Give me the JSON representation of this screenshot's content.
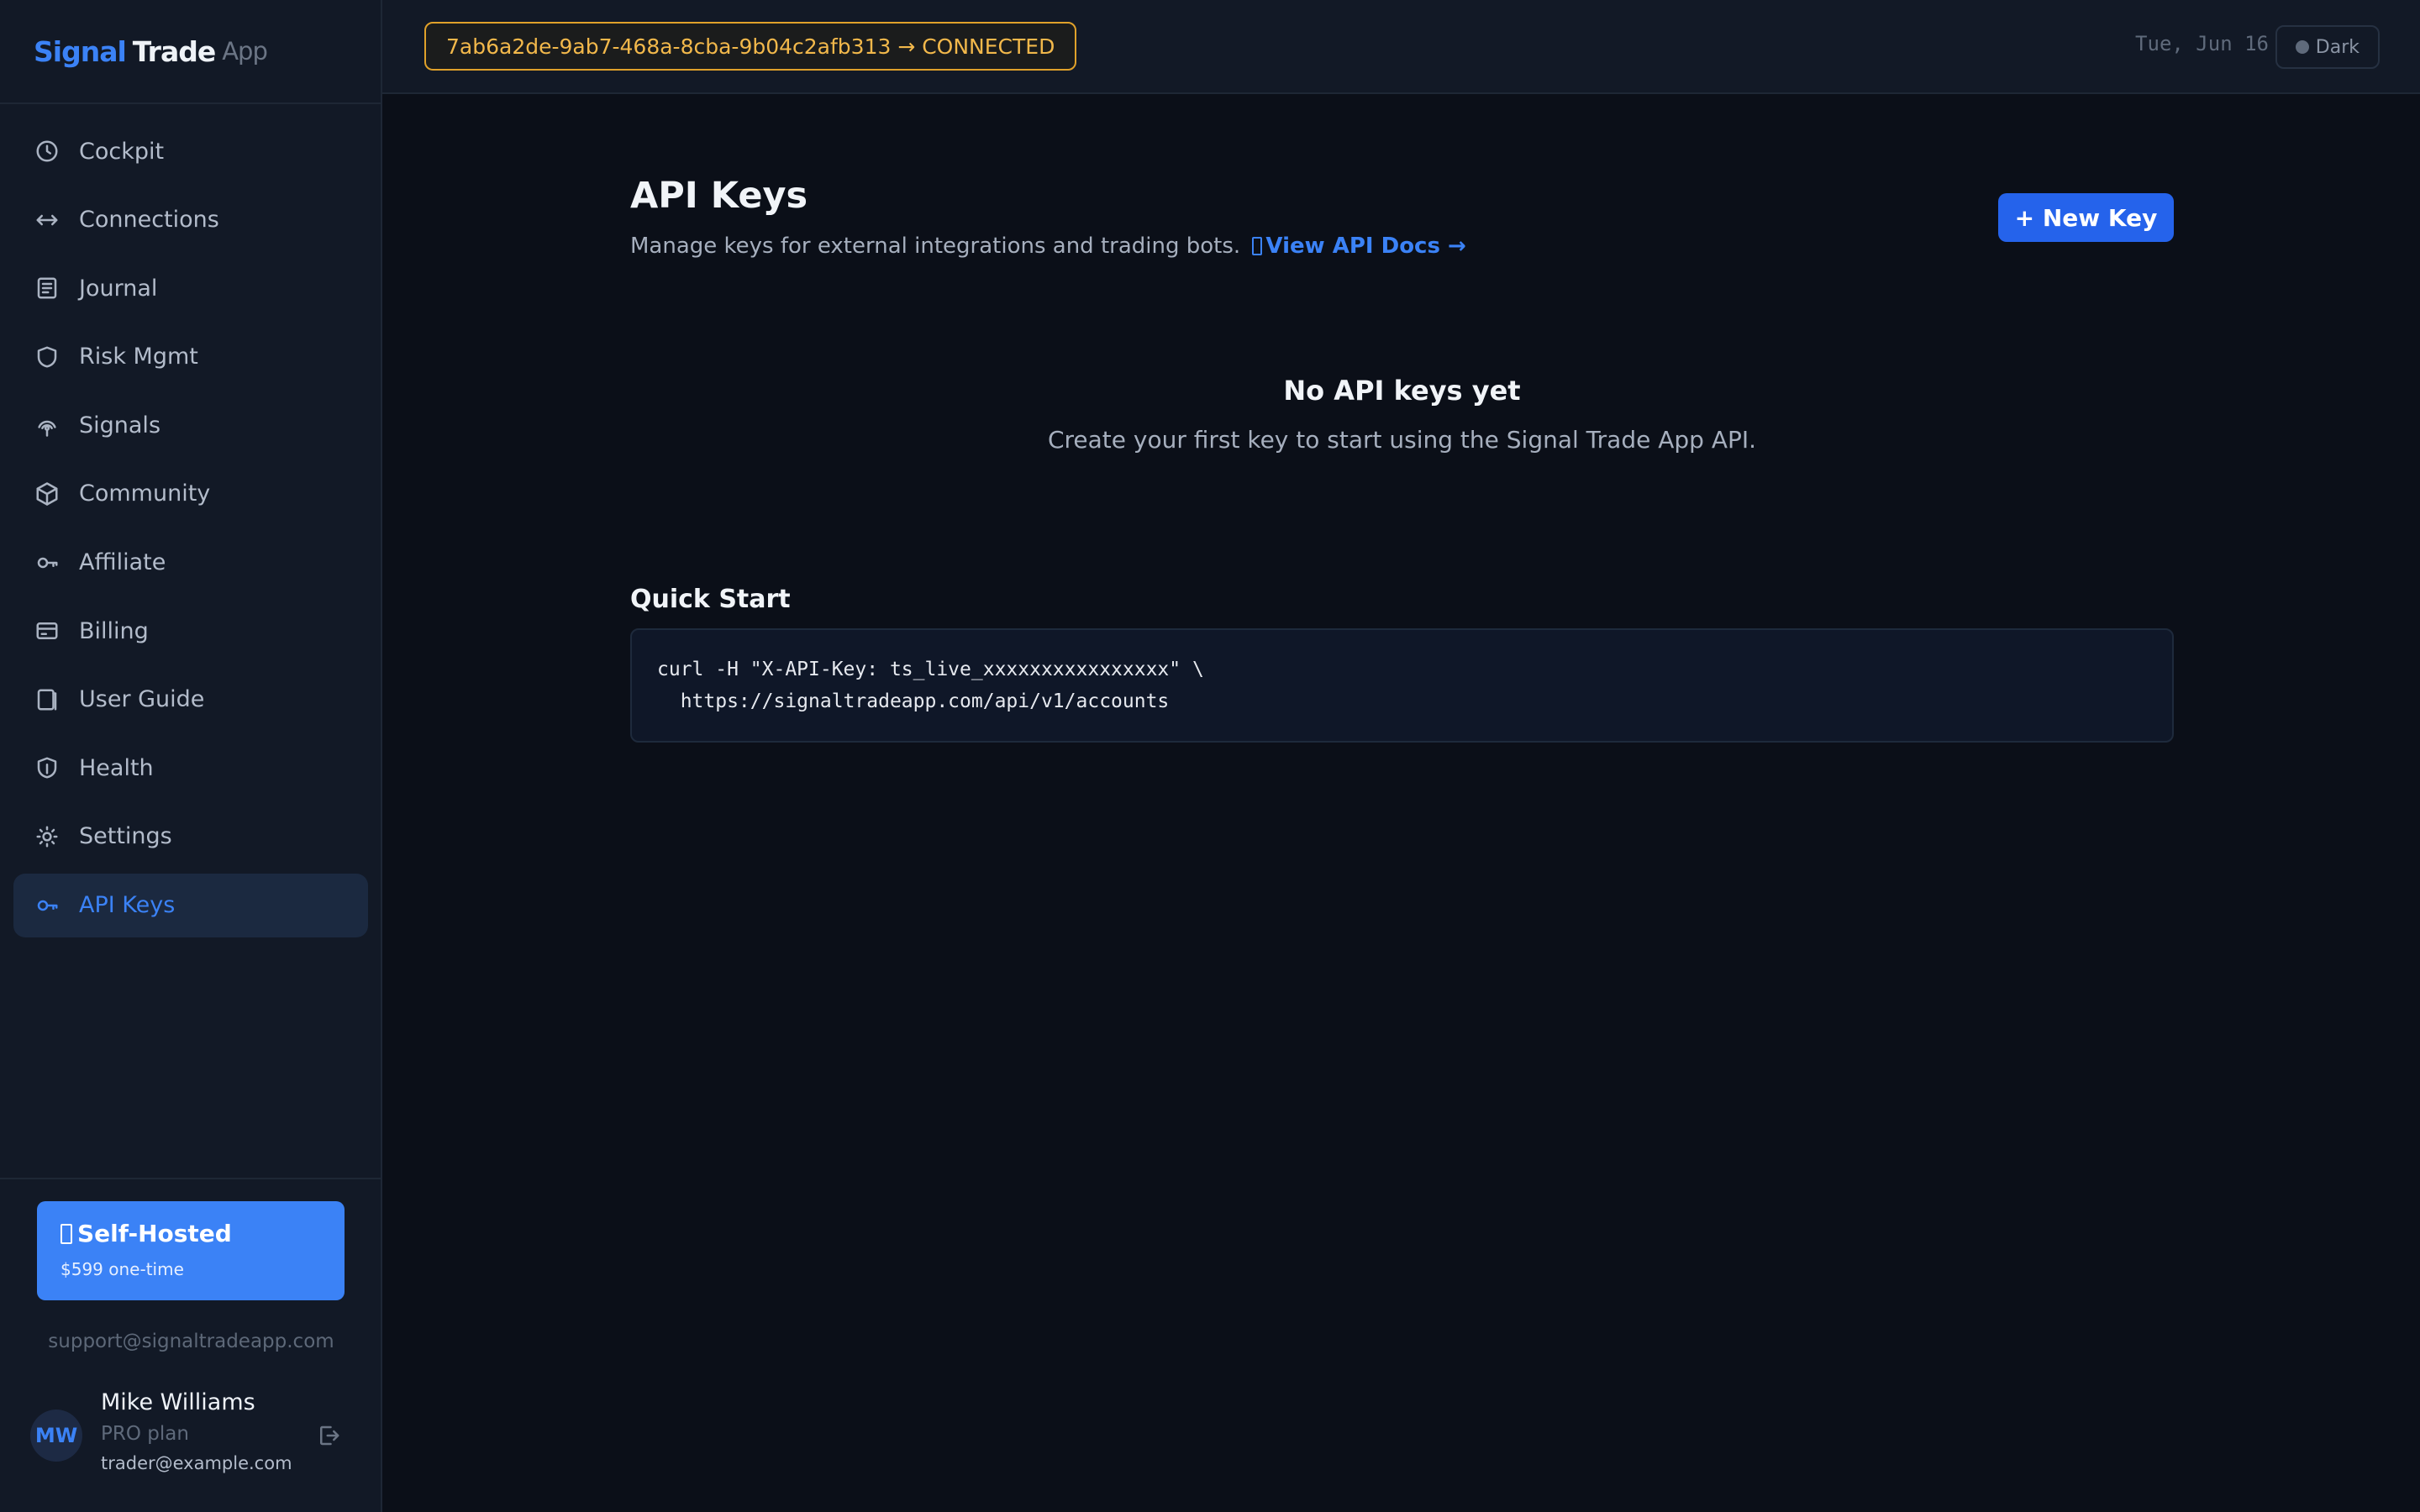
{
  "brand": {
    "part1": "Signal",
    "part2": "Trade",
    "part3": "App"
  },
  "sidebar": {
    "items": [
      {
        "label": "Cockpit",
        "icon": "clock-icon"
      },
      {
        "label": "Connections",
        "icon": "arrows-horizontal-icon"
      },
      {
        "label": "Journal",
        "icon": "journal-icon"
      },
      {
        "label": "Risk Mgmt",
        "icon": "shield-icon"
      },
      {
        "label": "Signals",
        "icon": "broadcast-icon"
      },
      {
        "label": "Community",
        "icon": "cube-icon"
      },
      {
        "label": "Affiliate",
        "icon": "key-icon"
      },
      {
        "label": "Billing",
        "icon": "credit-card-icon"
      },
      {
        "label": "User Guide",
        "icon": "book-icon"
      },
      {
        "label": "Health",
        "icon": "heart-shield-icon"
      },
      {
        "label": "Settings",
        "icon": "sun-gear-icon"
      },
      {
        "label": "API Keys",
        "icon": "key-icon",
        "active": true
      }
    ],
    "promo": {
      "title": "Self-Hosted",
      "subtitle": "$599 one-time"
    },
    "support_email": "support@signaltradeapp.com",
    "user": {
      "initials": "MW",
      "name": "Mike Williams",
      "plan": "PRO plan",
      "email": "trader@example.com"
    }
  },
  "topbar": {
    "connection": "7ab6a2de-9ab7-468a-8cba-9b04c2afb313 → CONNECTED",
    "date": "Tue, Jun 16",
    "theme_label": "Dark"
  },
  "main": {
    "title": "API Keys",
    "subtitle": "Manage keys for external integrations and trading bots.",
    "docs_link": "View API Docs →",
    "new_key_label": "+ New Key",
    "empty_title": "No API keys yet",
    "empty_subtitle": "Create your first key to start using the Signal Trade App API.",
    "quick_start_title": "Quick Start",
    "code": "curl -H \"X-API-Key: ts_live_xxxxxxxxxxxxxxxx\" \\\n  https://signaltradeapp.com/api/v1/accounts"
  },
  "colors": {
    "accent": "#3b82f6",
    "button": "#2563eb",
    "warning": "#e0a12a",
    "background": "#0b0f18",
    "sidebar": "#121926"
  }
}
